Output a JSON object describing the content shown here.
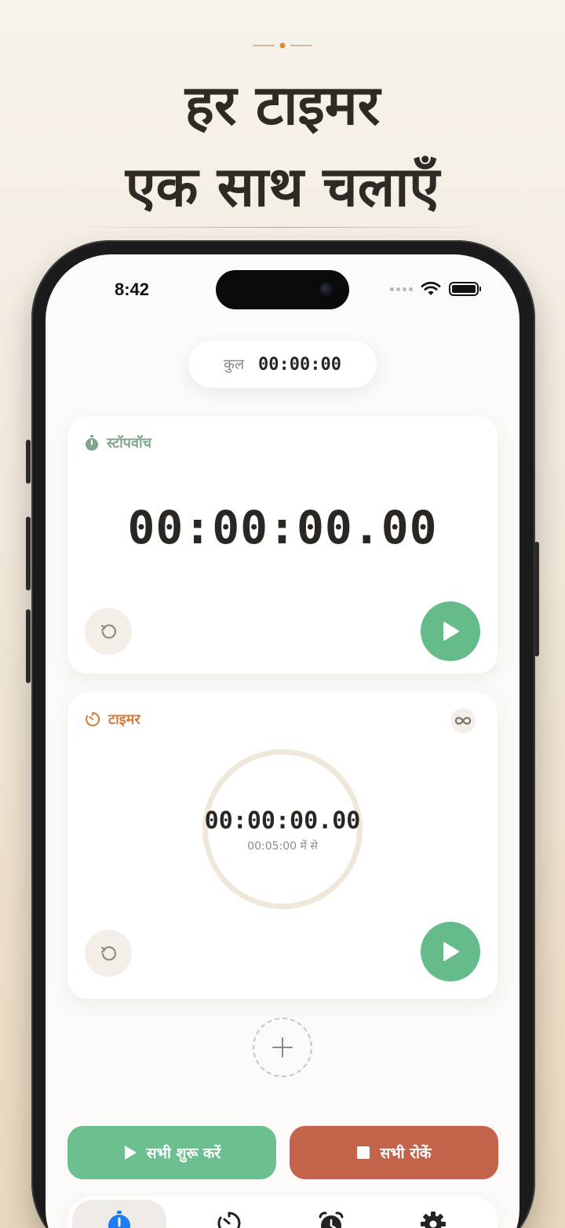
{
  "headline": {
    "line1": "हर टाइमर",
    "line2": "एक साथ चलाएँ"
  },
  "status_bar": {
    "time": "8:42"
  },
  "total": {
    "label": "कुल",
    "value": "00:00:00"
  },
  "stopwatch_card": {
    "title": "स्टॉपवॉच",
    "icon": "stopwatch-icon",
    "time": "00:00:00.00"
  },
  "timer_card": {
    "title": "टाइमर",
    "icon": "timer-icon",
    "time": "00:00:00.00",
    "subtitle": "00:05:00 में से",
    "progress": 0
  },
  "actions": {
    "start_all": "सभी शुरू करें",
    "stop_all": "सभी रोकें"
  },
  "tabs": [
    {
      "icon": "stopwatch-icon",
      "active": true
    },
    {
      "icon": "timer-icon",
      "active": false
    },
    {
      "icon": "alarm-clock-icon",
      "active": false
    },
    {
      "icon": "gear-icon",
      "active": false
    }
  ],
  "colors": {
    "play_green": "#66bb8b",
    "stop_red": "#c2634a",
    "stopwatch_accent": "#7fa68a",
    "timer_accent": "#d67a3a",
    "tab_active_blue": "#1e7cf2"
  }
}
